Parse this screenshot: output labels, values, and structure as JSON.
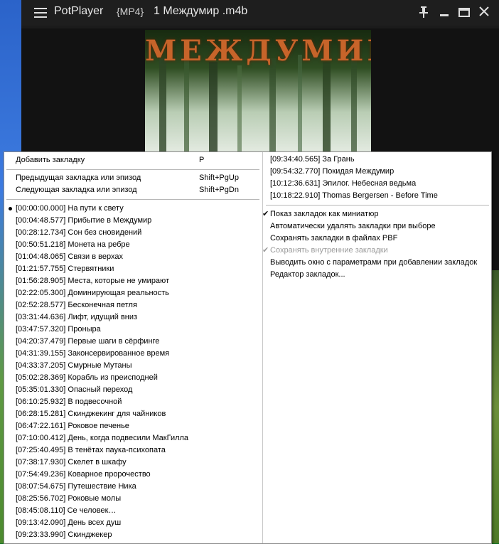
{
  "window": {
    "app_name": "PotPlayer",
    "format": "{MP4}",
    "file_name": "1 Междумир .m4b"
  },
  "cover": {
    "title": "МЕЖДУМИР"
  },
  "menu": {
    "add_bookmark": {
      "label": "Добавить закладку",
      "shortcut": "P"
    },
    "prev_bookmark": {
      "label": "Предыдущая закладка или эпизод",
      "shortcut": "Shift+PgUp"
    },
    "next_bookmark": {
      "label": "Следующая закладка или эпизод",
      "shortcut": "Shift+PgDn"
    },
    "chapters_left": [
      "[00:00:00.000] На пути к свету",
      "[00:04:48.577] Прибытие в Междумир",
      "[00:28:12.734] Сон без сновидений",
      "[00:50:51.218] Монета на ребре",
      "[01:04:48.065] Связи в верхах",
      "[01:21:57.755] Стервятники",
      "[01:56:28.905] Места, которые не умирают",
      "[02:22:05.300] Доминирующая реальность",
      "[02:52:28.577] Бесконечная петля",
      "[03:31:44.636] Лифт, идущий вниз",
      "[03:47:57.320] Проныра",
      "[04:20:37.479] Первые шаги в сёрфинге",
      "[04:31:39.155] Законсервированное время",
      "[04:33:37.205] Смурные Мутаны",
      "[05:02:28.369] Корабль из преисподней",
      "[05:35:01.330] Опасный переход",
      "[06:10:25.932] В подвесочной",
      "[06:28:15.281] Скинджекинг для чайников",
      "[06:47:22.161] Роковое печенье",
      "[07:10:00.412] День, когда подвесили МакГилла",
      "[07:25:40.495] В тенётах паука-психопата",
      "[07:38:17.930] Скелет в шкафу",
      "[07:54:49.236] Коварное пророчество",
      "[08:07:54.675] Путешествие Ника",
      "[08:25:56.702] Роковые молы",
      "[08:45:08.110] Се человек…",
      "[09:13:42.090] День всех душ",
      "[09:23:33.990] Скинджекер"
    ],
    "chapters_right": [
      "[09:34:40.565] За Грань",
      "[09:54:32.770] Покидая Междумир",
      "[10:12:36.631] Эпилог. Небесная ведьма",
      "[10:18:22.910] Thomas Bergersen - Before Time"
    ],
    "options": [
      {
        "label": "Показ закладок как миниатюр",
        "checked": true,
        "disabled": false
      },
      {
        "label": "Автоматически удалять закладки при выборе",
        "checked": false,
        "disabled": false
      },
      {
        "label": "Сохранять закладки в файлах PBF",
        "checked": false,
        "disabled": false
      },
      {
        "label": "Сохранять внутренние закладки",
        "checked": true,
        "disabled": true
      },
      {
        "label": "Выводить окно с параметрами при добавлении закладок",
        "checked": false,
        "disabled": false
      },
      {
        "label": "Редактор закладок...",
        "checked": false,
        "disabled": false
      }
    ]
  }
}
